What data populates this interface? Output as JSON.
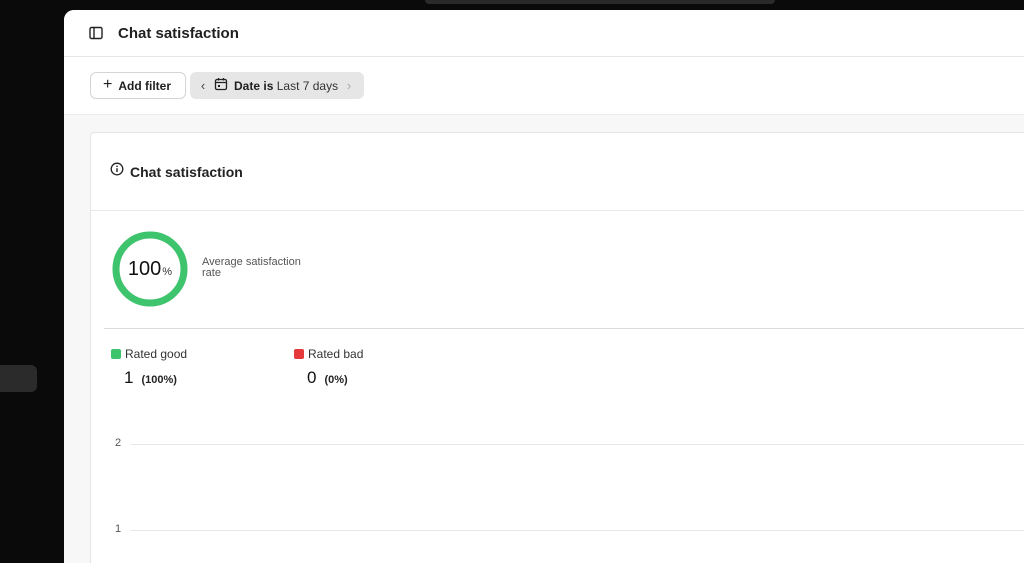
{
  "page": {
    "title": "Chat satisfaction"
  },
  "filters": {
    "add_filter_label": "Add filter",
    "date_chip": {
      "field": "Date is",
      "value": "Last 7 days"
    }
  },
  "card": {
    "title": "Chat satisfaction",
    "summary": {
      "value": "100",
      "unit": "%",
      "fill_fraction": 1.0,
      "label": "Average satisfaction rate"
    },
    "legend": [
      {
        "label": "Rated good",
        "count": "1",
        "percent": "(100%)",
        "color": "#3ec46d"
      },
      {
        "label": "Rated bad",
        "count": "0",
        "percent": "(0%)",
        "color": "#e5393b"
      }
    ],
    "chart": {
      "y_ticks": [
        "2",
        "1"
      ]
    }
  },
  "colors": {
    "ring_good": "#3ec46d",
    "rated_good": "#3ec46d",
    "rated_bad": "#e5393b"
  },
  "icons": {
    "sidebar_toggle": "sidebar-toggle-icon",
    "add": "plus-icon",
    "calendar": "calendar-icon",
    "info": "info-icon",
    "prev": "chevron-left-icon",
    "next": "chevron-right-icon"
  }
}
